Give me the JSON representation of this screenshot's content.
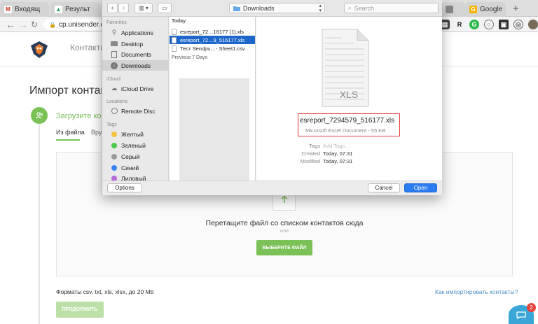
{
  "browser": {
    "tabs": [
      {
        "label": "Входящ",
        "favicon": "gmail-icon",
        "color": "#d93025",
        "glyph": "M"
      },
      {
        "label": "Результ",
        "favicon": "google-drive-icon",
        "color": "#f4b400",
        "glyph": "▲"
      },
      {
        "label": "Google",
        "favicon": "google-icon",
        "color": "#f4b400",
        "glyph": "G"
      }
    ],
    "new_tab_label": "+",
    "url": "cp.unisender.c",
    "lock_glyph": "🔒"
  },
  "page": {
    "nav_contacts": "Контакты",
    "title": "Импорт контакто",
    "step_title": "Загрузите конт",
    "subtab_file": "Из файла",
    "subtab_other": "Вруч",
    "drop_text": "Перетащите файл со списком контактов сюда",
    "drop_or": "или",
    "choose_button": "ВЫБЕРИТЕ ФАЙЛ",
    "formats": "Форматы csv, txt, xls, xlsx, до 20 Mb",
    "howto_link": "Как импортировать контакты?",
    "continue_button": "ПРОДОЛЖИТЬ",
    "chat_badge": "2"
  },
  "dialog": {
    "location": "Downloads",
    "search_placeholder": "Search",
    "sidebar": {
      "favorites_head": "Favorites",
      "favorites": [
        {
          "label": "Applications",
          "icon": "applications-icon"
        },
        {
          "label": "Desktop",
          "icon": "desktop-icon"
        },
        {
          "label": "Documents",
          "icon": "documents-icon"
        },
        {
          "label": "Downloads",
          "icon": "downloads-icon",
          "selected": true
        }
      ],
      "icloud_head": "iCloud",
      "icloud": [
        {
          "label": "iCloud Drive",
          "icon": "cloud-icon"
        }
      ],
      "locations_head": "Locations",
      "locations": [
        {
          "label": "Remote Disc",
          "icon": "disc-icon"
        }
      ],
      "tags_head": "Tags",
      "tags": [
        {
          "label": "Желтый",
          "color": "#f5c242"
        },
        {
          "label": "Зеленый",
          "color": "#4cc84a"
        },
        {
          "label": "Серый",
          "color": "#9a9a9a"
        },
        {
          "label": "Синий",
          "color": "#3b82f6"
        },
        {
          "label": "Лиловый",
          "color": "#b36ad6"
        }
      ]
    },
    "files": {
      "today_head": "Today",
      "today": [
        {
          "name": "esreport_72…16177 (1).xls",
          "selected": false
        },
        {
          "name": "esreport_72…9_516177.xls",
          "selected": true
        },
        {
          "name": "Тест Sendpu…- Sheet1.csv",
          "selected": false
        }
      ],
      "prev_head": "Previous 7 Days"
    },
    "preview": {
      "file_name": "esreport_7294579_516177.xls",
      "file_kind": "Microsoft Excel Document - 55 KB",
      "icon_label": "XLS",
      "tags_key": "Tags",
      "tags_val": "Add Tags…",
      "created_key": "Created",
      "created_val": "Today, 07:31",
      "modified_key": "Modified",
      "modified_val": "Today, 07:31"
    },
    "options_button": "Options",
    "cancel_button": "Cancel",
    "open_button": "Open"
  }
}
